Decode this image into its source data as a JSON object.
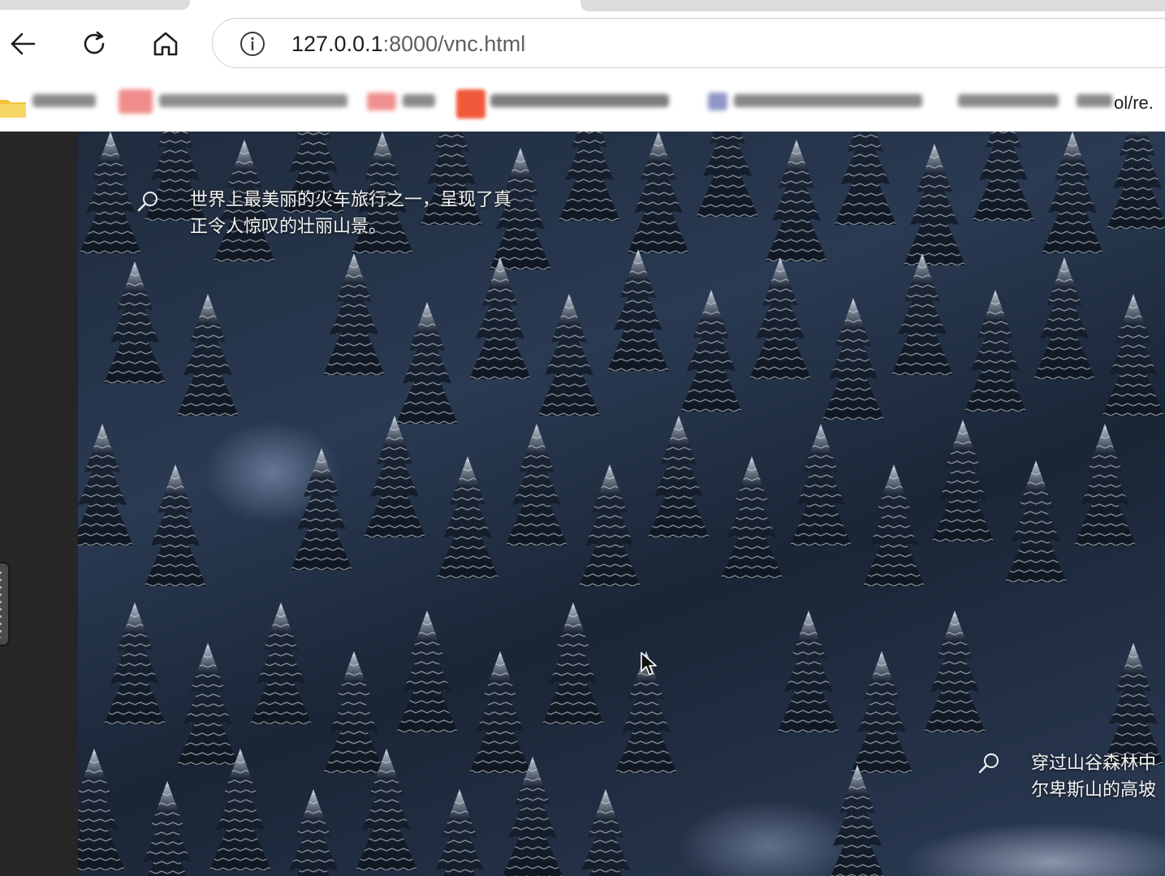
{
  "browser": {
    "url_host": "127.0.0.1",
    "url_rest": ":8000/vnc.html",
    "bookmark_partial": "ol/re."
  },
  "desktop": {
    "spotlight_top": {
      "line1": "世界上最美丽的火车旅行之一，呈现了真",
      "line2": "正令人惊叹的壮丽山景。"
    },
    "spotlight_bottom": {
      "line1": "穿过山谷森林中",
      "line2": "尔卑斯山的高坡"
    }
  },
  "colors": {
    "left_panel": "#262626",
    "accent_bookmark_red": "#f05a3a",
    "accent_bookmark_pink": "#f4a0a0"
  }
}
